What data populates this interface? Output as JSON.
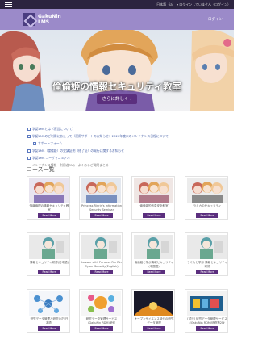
{
  "topbar": {
    "links": "日本語（ja）  ▾   ログインしていません（ログイン）"
  },
  "header": {
    "logo_text": "GakuNin\nLMS",
    "login": "ログイン"
  },
  "hero": {
    "title": "倫倫姫の情報セキュリティ教室",
    "button": "さらに詳しく ›"
  },
  "news": [
    {
      "text": "学認LMSとは（運営について）",
      "level": 0
    },
    {
      "text": "学認LMSのご利用にあたって（運用サポートのお知らせ：2020年度末のメンテナンス日程について）",
      "level": 0
    },
    {
      "text": "サポートフォーム",
      "level": 1
    },
    {
      "text": "学認LMS（倫倫姫）の受講証明（修了証）の発行に関するお知らせ",
      "level": 0
    },
    {
      "text": "学認LMS ユーザマニュアル",
      "level": 0
    },
    {
      "text": "メンテナンス情報　利用者FAQ　よくあるご質問まとめ",
      "level": 2
    }
  ],
  "section_title": "コース一覧",
  "courses": [
    {
      "title": "情報倫理の情報セキュリティ教室",
      "button": "Read More"
    },
    {
      "title": "Princess Rinrin's Information Security Seminar",
      "button": "Read More"
    },
    {
      "title": "倫倫姫的信息安全教室",
      "button": "Read More"
    },
    {
      "title": "ラミカのセキュリティ",
      "button": "Read More"
    },
    {
      "title": "情報セキュリティ研修(日本語)",
      "button": "Read More"
    },
    {
      "title": "Lesson with Princess Rin Rin Cyber Security(English)",
      "button": "Read More"
    },
    {
      "title": "倫倫姫と学ぶ情報セキュリティ(中国語)",
      "button": "Read More"
    },
    {
      "title": "ラミカと学ぶ 情報セキュリティ研修",
      "button": "Read More"
    },
    {
      "title": "研究データ管理と研究公正(日本語)",
      "button": "Read More"
    },
    {
      "title": "研究データ管理サービス(GakuNin RDM)研修",
      "button": "Read More"
    },
    {
      "title": "オープンサイエンス時代の研究データ管理",
      "button": "Read More"
    },
    {
      "title": "[試行] 研究データ管理サービス(GakuNin RDM)研修第2版",
      "button": "Read More"
    }
  ],
  "colors": {
    "brand": "#9b8ac9",
    "accent": "#5b2f7e",
    "link": "#4a63a8"
  }
}
